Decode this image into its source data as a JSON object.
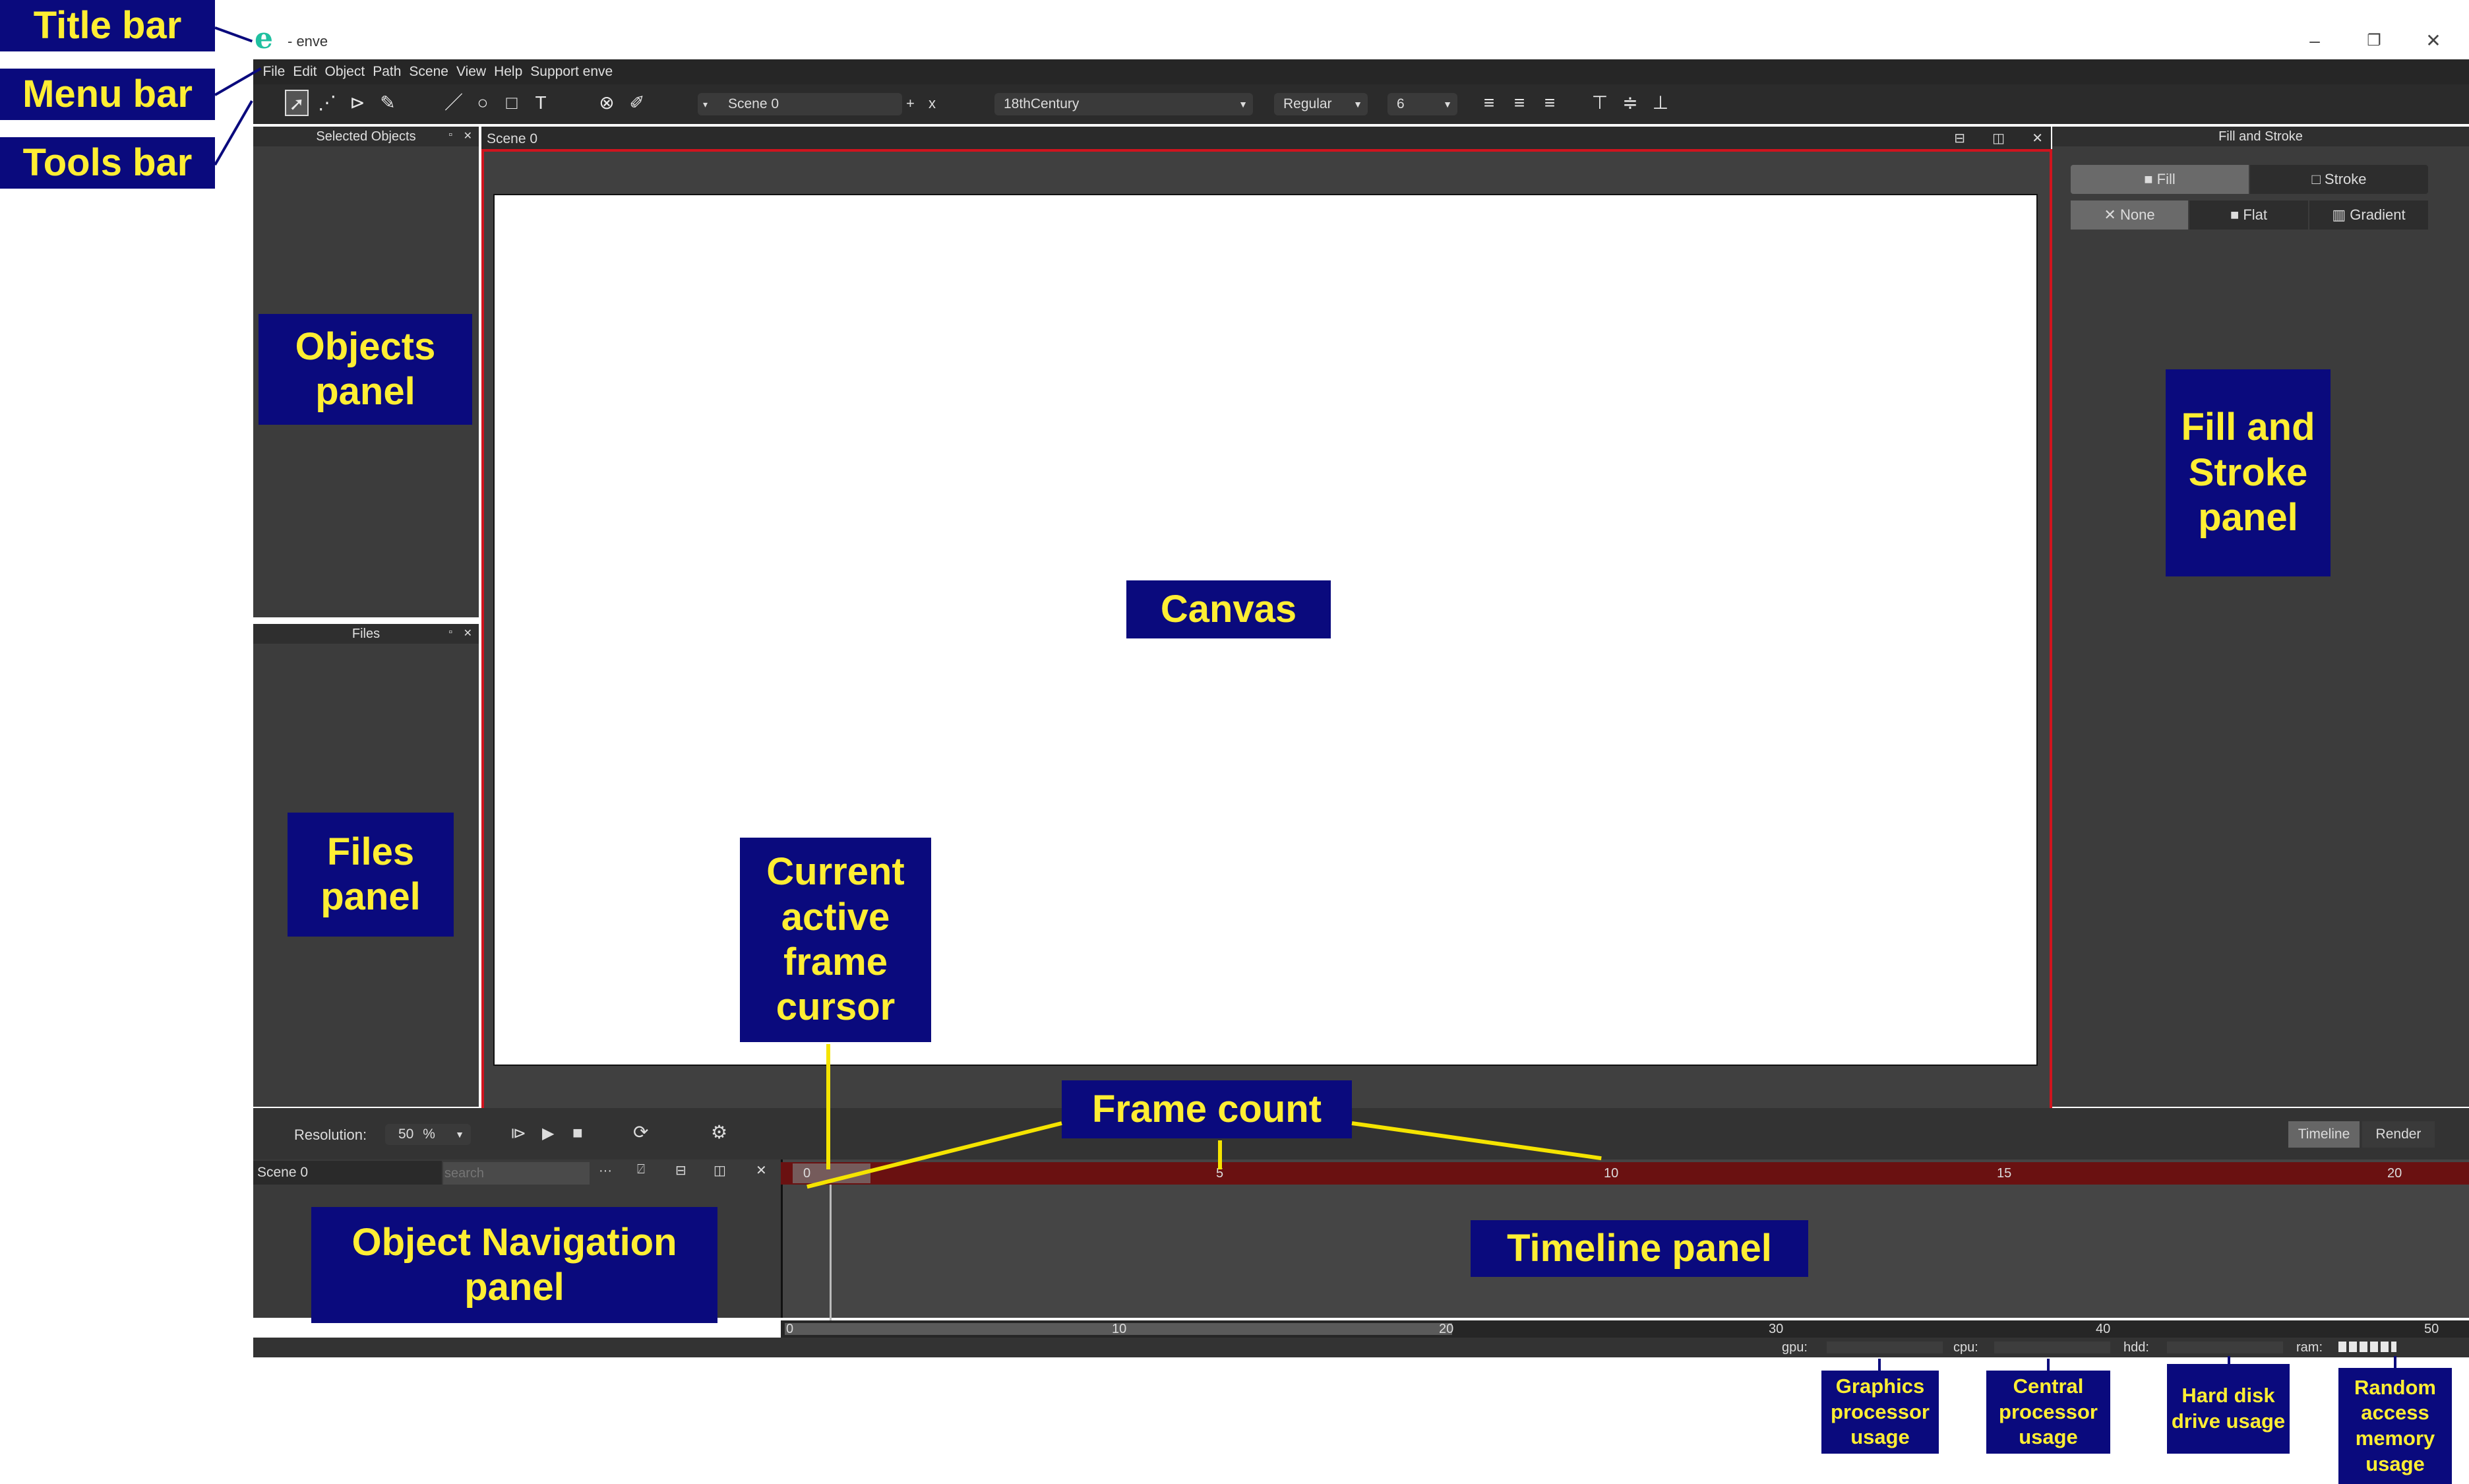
{
  "window": {
    "title": "- enve",
    "minimize": "–",
    "restore": "❐",
    "close": "✕"
  },
  "menu": [
    "File",
    "Edit",
    "Object",
    "Path",
    "Scene",
    "View",
    "Help",
    "Support enve"
  ],
  "toolbar": {
    "scene_name": "Scene 0",
    "scene_add": "+",
    "scene_remove": "x",
    "font_family": "18thCentury",
    "font_style": "Regular",
    "font_size": "6"
  },
  "panels": {
    "selected_objects": "Selected Objects",
    "files": "Files",
    "canvas_tab": "Scene 0",
    "fill_stroke": "Fill and Stroke"
  },
  "fill_stroke": {
    "tabs": [
      "Fill",
      "Stroke"
    ],
    "modes": [
      "None",
      "Flat",
      "Gradient"
    ]
  },
  "bottom": {
    "resolution_label": "Resolution:",
    "resolution_value": "50",
    "resolution_unit": "%",
    "timeline_tab": "Timeline",
    "render_tab": "Render",
    "scene_name": "Scene 0",
    "search_placeholder": "search",
    "more": "···",
    "frame_ticks": [
      "0",
      "5",
      "10",
      "15",
      "20"
    ],
    "range_ticks": [
      "0",
      "10",
      "20",
      "30",
      "40",
      "50"
    ],
    "usage": {
      "gpu": "gpu:",
      "cpu": "cpu:",
      "hdd": "hdd:",
      "ram": "ram:"
    }
  },
  "annotations": {
    "title_bar": "Title bar",
    "menu_bar": "Menu bar",
    "tools_bar": "Tools bar",
    "objects_panel": "Objects panel",
    "files_panel": "Files panel",
    "canvas": "Canvas",
    "fill_stroke_panel": "Fill and Stroke panel",
    "current_frame": "Current active frame cursor",
    "frame_count": "Frame count",
    "object_nav": "Object Navigation panel",
    "timeline_panel": "Timeline panel",
    "gpu": "Graphics processor usage",
    "cpu": "Central processor usage",
    "hdd": "Hard disk drive usage",
    "ram": "Random access memory usage"
  },
  "colors": {
    "accent_red": "#d0141e",
    "callout_bg": "#0a0a7d",
    "callout_text": "#ffee33",
    "logo": "#20c0a0"
  }
}
